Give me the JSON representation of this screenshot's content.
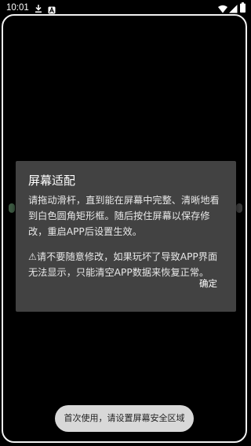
{
  "status_bar": {
    "time": "10:01",
    "icons": [
      "download-icon",
      "a-notification-icon",
      "wifi-icon",
      "signal-icon",
      "battery-icon"
    ]
  },
  "dialog": {
    "title": "屏幕适配",
    "paragraph1": "请拖动滑杆，直到能在屏幕中完整、清晰地看到白色圆角矩形框。随后按住屏幕以保存修改，重启APP后设置生效。",
    "paragraph2": "⚠请不要随意修改，如果玩坏了导致APP界面无法显示，只能清空APP数据来恢复正常。",
    "ok_label": "确定"
  },
  "toast": {
    "text": "首次使用，请设置屏幕安全区域"
  },
  "colors": {
    "background": "#000000",
    "dialog_bg": "#424242",
    "frame": "#f2f2f2",
    "toast_bg": "#d8d8d8"
  }
}
